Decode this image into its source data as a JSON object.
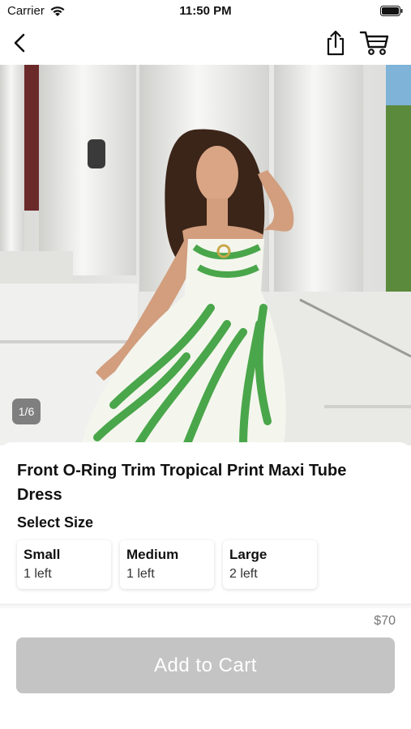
{
  "status_bar": {
    "carrier": "Carrier",
    "time": "11:50 PM"
  },
  "nav": {
    "back_icon": "chevron-left-icon",
    "share_icon": "share-icon",
    "cart_icon": "cart-icon"
  },
  "gallery": {
    "counter": "1/6",
    "current": 1,
    "total": 6
  },
  "product": {
    "title": "Front O-Ring Trim Tropical Print Maxi Tube Dress",
    "select_size_label": "Select Size",
    "sizes": [
      {
        "name": "Small",
        "stock": "1 left"
      },
      {
        "name": "Medium",
        "stock": "1 left"
      },
      {
        "name": "Large",
        "stock": "2 left"
      }
    ],
    "price": "$70"
  },
  "actions": {
    "add_to_cart_label": "Add to Cart",
    "add_to_cart_color": "#c4c4c4"
  }
}
